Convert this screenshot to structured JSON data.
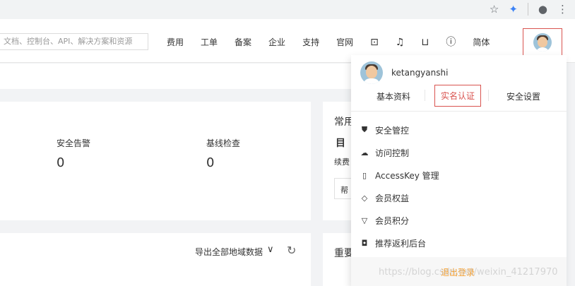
{
  "browser": {
    "icons": [
      "star-icon",
      "extension-icon",
      "profile-icon",
      "more-icon"
    ]
  },
  "header": {
    "search_placeholder": "文档、控制台、API、解决方案和资源",
    "nav": [
      "费用",
      "工单",
      "备案",
      "企业",
      "支持",
      "官网"
    ],
    "lang": "简体",
    "icons": [
      "terminal-icon",
      "bell-icon",
      "cart-icon",
      "help-icon"
    ]
  },
  "card_security": {
    "alert_label": "安全告警",
    "alert_value": "0",
    "baseline_label": "基线检查",
    "baseline_value": "0"
  },
  "card_common": {
    "title": "常用",
    "subtitle_glyph": "目",
    "renew": "续费",
    "help": "帮"
  },
  "card_region": {
    "export_label": "导出全部地域数据",
    "chevron": "∨"
  },
  "card_important": {
    "title": "重要"
  },
  "dropdown": {
    "username": "ketangyanshi",
    "links": [
      {
        "label": "基本资料",
        "active": false
      },
      {
        "label": "实名认证",
        "active": true
      },
      {
        "label": "安全设置",
        "active": false
      }
    ],
    "items": [
      {
        "icon": "shield-icon",
        "glyph": "⛊",
        "label": "安全管控"
      },
      {
        "icon": "cloud-icon",
        "glyph": "☁",
        "label": "访问控制"
      },
      {
        "icon": "key-icon",
        "glyph": "▯",
        "label": "AccessKey 管理"
      },
      {
        "icon": "diamond-icon",
        "glyph": "◇",
        "label": "会员权益"
      },
      {
        "icon": "gem-icon",
        "glyph": "▽",
        "label": "会员积分"
      },
      {
        "icon": "id-card-icon",
        "glyph": "◘",
        "label": "推荐返利后台"
      }
    ],
    "logout": "退出登录"
  },
  "watermark": "https://blog.csdn.net/weixin_41217970",
  "colors": {
    "accent_red": "#d9534f",
    "logout_orange": "#f59a23"
  }
}
